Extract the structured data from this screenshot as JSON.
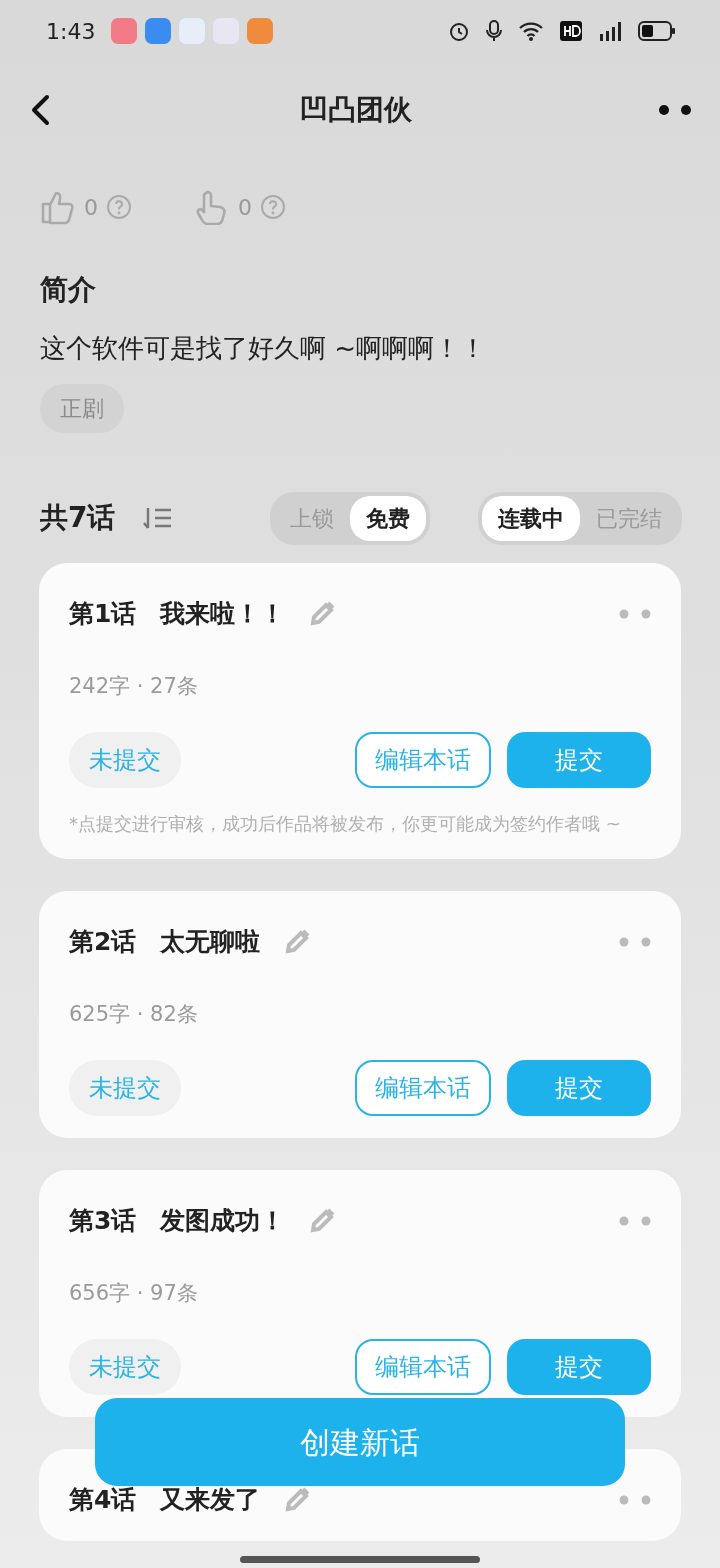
{
  "status_bar": {
    "time": "1:43"
  },
  "header": {
    "title": "凹凸团伙"
  },
  "reactions": [
    {
      "kind": "thumb",
      "count": "0"
    },
    {
      "kind": "point",
      "count": "0"
    }
  ],
  "intro": {
    "heading": "简介",
    "text": "这个软件可是找了好久啊 ~啊啊啊！！",
    "tags": [
      "正剧"
    ]
  },
  "episodes_header": {
    "count": "共7话",
    "filter_groups": [
      [
        {
          "label": "上锁",
          "selected": false
        },
        {
          "label": "免费",
          "selected": true
        }
      ],
      [
        {
          "label": "连载中",
          "selected": true
        },
        {
          "label": "已完结",
          "selected": false
        }
      ]
    ]
  },
  "episodes": [
    {
      "number": "第1话",
      "title": "我来啦！！",
      "stats": "242字 · 27条",
      "status": "未提交",
      "edit_button": "编辑本话",
      "submit_button": "提交",
      "note": "*点提交进行审核，成功后作品将被发布，你更可能成为签约作者哦 ~"
    },
    {
      "number": "第2话",
      "title": "太无聊啦",
      "stats": "625字 · 82条",
      "status": "未提交",
      "edit_button": "编辑本话",
      "submit_button": "提交"
    },
    {
      "number": "第3话",
      "title": "发图成功！",
      "stats": "656字 · 97条",
      "status": "未提交",
      "edit_button": "编辑本话",
      "submit_button": "提交"
    },
    {
      "number": "第4话",
      "title": "又来发了"
    }
  ],
  "create_button": "创建新话"
}
